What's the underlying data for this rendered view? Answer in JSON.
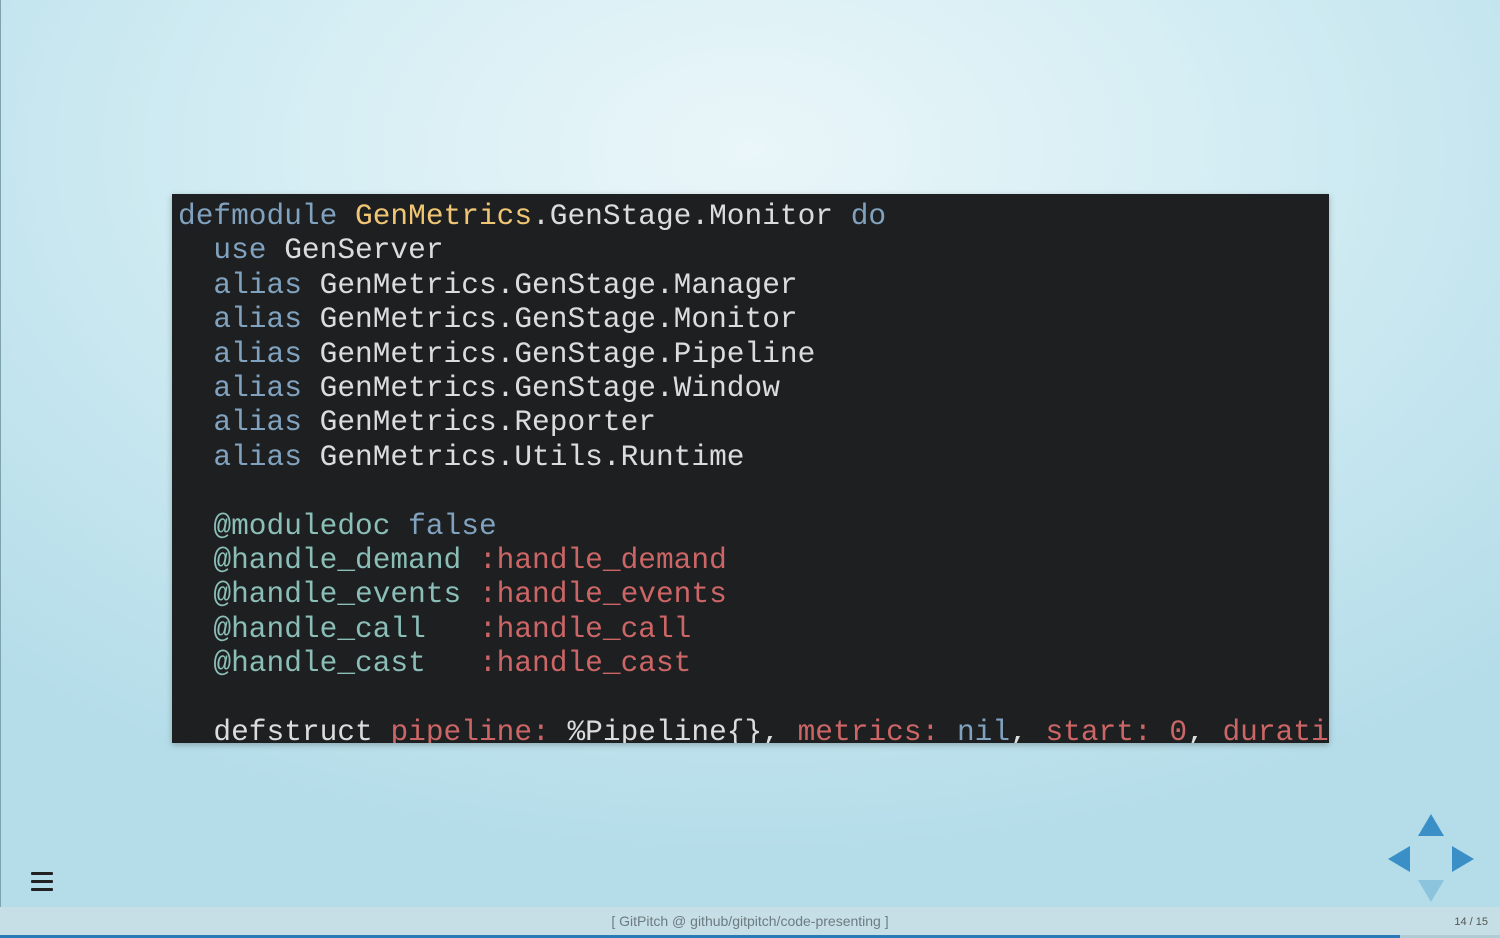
{
  "colors": {
    "code_background": "#1d1f21",
    "keyword": "#81a2be",
    "module_name": "#f0c674",
    "attribute": "#8abeb7",
    "atom": "#cc6666",
    "plain": "#dcdcdc",
    "nav_arrow": "#3a8fc7",
    "progress": "#2a7ab8"
  },
  "code": {
    "lines": [
      [
        {
          "t": "defmodule",
          "c": "kw"
        },
        {
          "t": " ",
          "c": "plain"
        },
        {
          "t": "GenMetrics",
          "c": "mod"
        },
        {
          "t": ".GenStage.Monitor ",
          "c": "plain"
        },
        {
          "t": "do",
          "c": "kw"
        }
      ],
      [
        {
          "t": "  ",
          "c": "plain"
        },
        {
          "t": "use",
          "c": "kw"
        },
        {
          "t": " GenServer",
          "c": "plain"
        }
      ],
      [
        {
          "t": "  ",
          "c": "plain"
        },
        {
          "t": "alias",
          "c": "kw"
        },
        {
          "t": " GenMetrics.GenStage.Manager",
          "c": "plain"
        }
      ],
      [
        {
          "t": "  ",
          "c": "plain"
        },
        {
          "t": "alias",
          "c": "kw"
        },
        {
          "t": " GenMetrics.GenStage.Monitor",
          "c": "plain"
        }
      ],
      [
        {
          "t": "  ",
          "c": "plain"
        },
        {
          "t": "alias",
          "c": "kw"
        },
        {
          "t": " GenMetrics.GenStage.Pipeline",
          "c": "plain"
        }
      ],
      [
        {
          "t": "  ",
          "c": "plain"
        },
        {
          "t": "alias",
          "c": "kw"
        },
        {
          "t": " GenMetrics.GenStage.Window",
          "c": "plain"
        }
      ],
      [
        {
          "t": "  ",
          "c": "plain"
        },
        {
          "t": "alias",
          "c": "kw"
        },
        {
          "t": " GenMetrics.Reporter",
          "c": "plain"
        }
      ],
      [
        {
          "t": "  ",
          "c": "plain"
        },
        {
          "t": "alias",
          "c": "kw"
        },
        {
          "t": " GenMetrics.Utils.Runtime",
          "c": "plain"
        }
      ],
      [],
      [
        {
          "t": "  ",
          "c": "plain"
        },
        {
          "t": "@moduledoc",
          "c": "attr"
        },
        {
          "t": " ",
          "c": "plain"
        },
        {
          "t": "false",
          "c": "kw"
        }
      ],
      [
        {
          "t": "  ",
          "c": "plain"
        },
        {
          "t": "@handle_demand",
          "c": "attr"
        },
        {
          "t": " ",
          "c": "plain"
        },
        {
          "t": ":handle_demand",
          "c": "atom"
        }
      ],
      [
        {
          "t": "  ",
          "c": "plain"
        },
        {
          "t": "@handle_events",
          "c": "attr"
        },
        {
          "t": " ",
          "c": "plain"
        },
        {
          "t": ":handle_events",
          "c": "atom"
        }
      ],
      [
        {
          "t": "  ",
          "c": "plain"
        },
        {
          "t": "@handle_call",
          "c": "attr"
        },
        {
          "t": "   ",
          "c": "plain"
        },
        {
          "t": ":handle_call",
          "c": "atom"
        }
      ],
      [
        {
          "t": "  ",
          "c": "plain"
        },
        {
          "t": "@handle_cast",
          "c": "attr"
        },
        {
          "t": "   ",
          "c": "plain"
        },
        {
          "t": ":handle_cast",
          "c": "atom"
        }
      ],
      [],
      [
        {
          "t": "  defstruct ",
          "c": "plain"
        },
        {
          "t": "pipeline:",
          "c": "atom"
        },
        {
          "t": " %Pipeline{}, ",
          "c": "plain"
        },
        {
          "t": "metrics:",
          "c": "atom"
        },
        {
          "t": " ",
          "c": "plain"
        },
        {
          "t": "nil",
          "c": "kw"
        },
        {
          "t": ", ",
          "c": "plain"
        },
        {
          "t": "start:",
          "c": "atom"
        },
        {
          "t": " ",
          "c": "plain"
        },
        {
          "t": "0",
          "c": "atom"
        },
        {
          "t": ", ",
          "c": "plain"
        },
        {
          "t": "duration:",
          "c": "atom"
        }
      ]
    ]
  },
  "footer": {
    "text": "[ GitPitch @ github/gitpitch/code-presenting ]",
    "slide_counter": "14 / 15"
  },
  "progress": {
    "current": 14,
    "total": 15
  },
  "icons": {
    "menu": "hamburger-menu-icon",
    "nav_up": "arrow-up-icon",
    "nav_down": "arrow-down-icon",
    "nav_left": "arrow-left-icon",
    "nav_right": "arrow-right-icon"
  }
}
